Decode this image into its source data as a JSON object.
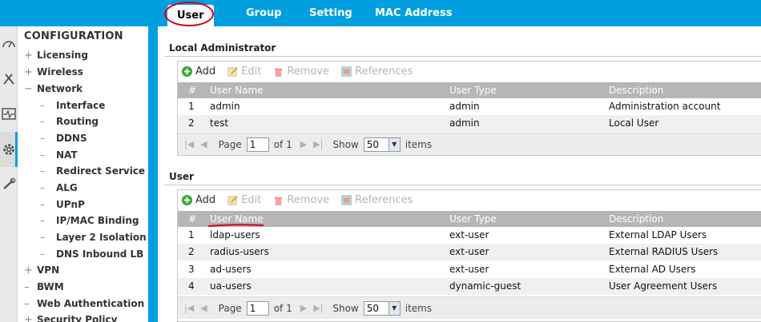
{
  "tabs": [
    {
      "label": "User",
      "active": true
    },
    {
      "label": "Group",
      "active": false
    },
    {
      "label": "Setting",
      "active": false
    },
    {
      "label": "MAC Address",
      "active": false
    }
  ],
  "rail": [
    {
      "icon": "dashboard-icon"
    },
    {
      "icon": "monitor-tools-icon"
    },
    {
      "icon": "pulse-monitor-icon"
    },
    {
      "icon": "gear-icon",
      "active": true
    },
    {
      "icon": "maintenance-icon"
    }
  ],
  "nav": {
    "title": "CONFIGURATION",
    "items": [
      {
        "label": "Licensing",
        "level": 0,
        "expander": "+"
      },
      {
        "label": "Wireless",
        "level": 0,
        "expander": "+"
      },
      {
        "label": "Network",
        "level": 0,
        "expander": "−"
      },
      {
        "label": "Interface",
        "level": 1,
        "expander": "–"
      },
      {
        "label": "Routing",
        "level": 1,
        "expander": "–"
      },
      {
        "label": "DDNS",
        "level": 1,
        "expander": "–"
      },
      {
        "label": "NAT",
        "level": 1,
        "expander": "–"
      },
      {
        "label": "Redirect Service",
        "level": 1,
        "expander": "–"
      },
      {
        "label": "ALG",
        "level": 1,
        "expander": "–"
      },
      {
        "label": "UPnP",
        "level": 1,
        "expander": "–"
      },
      {
        "label": "IP/MAC Binding",
        "level": 1,
        "expander": "–"
      },
      {
        "label": "Layer 2 Isolation",
        "level": 1,
        "expander": "–"
      },
      {
        "label": "DNS Inbound LB",
        "level": 1,
        "expander": "–"
      },
      {
        "label": "VPN",
        "level": 0,
        "expander": "+"
      },
      {
        "label": "BWM",
        "level": 0,
        "expander": "–"
      },
      {
        "label": "Web Authentication",
        "level": 0,
        "expander": "–"
      },
      {
        "label": "Security Policy",
        "level": 0,
        "expander": "+"
      }
    ]
  },
  "toolbar": {
    "add": "Add",
    "edit": "Edit",
    "remove": "Remove",
    "references": "References"
  },
  "columns": {
    "num": "#",
    "name": "User Name",
    "type": "User Type",
    "desc": "Description"
  },
  "pager": {
    "page_label": "Page",
    "page": "1",
    "of": "of 1",
    "show": "Show",
    "per_page": "50",
    "items": "items"
  },
  "local_admin": {
    "title": "Local Administrator",
    "rows": [
      {
        "num": "1",
        "name": "admin",
        "type": "admin",
        "desc": "Administration account"
      },
      {
        "num": "2",
        "name": "test",
        "type": "admin",
        "desc": "Local User"
      }
    ]
  },
  "users": {
    "title": "User",
    "rows": [
      {
        "num": "1",
        "name": "ldap-users",
        "type": "ext-user",
        "desc": "External LDAP Users"
      },
      {
        "num": "2",
        "name": "radius-users",
        "type": "ext-user",
        "desc": "External RADIUS Users"
      },
      {
        "num": "3",
        "name": "ad-users",
        "type": "ext-user",
        "desc": "External AD Users"
      },
      {
        "num": "4",
        "name": "ua-users",
        "type": "dynamic-guest",
        "desc": "User Agreement Users"
      }
    ]
  },
  "colors": {
    "brand": "#00a0e0",
    "header": "#b6b6b6",
    "annotation": "#d0021b",
    "add_green": "#3aa635"
  }
}
